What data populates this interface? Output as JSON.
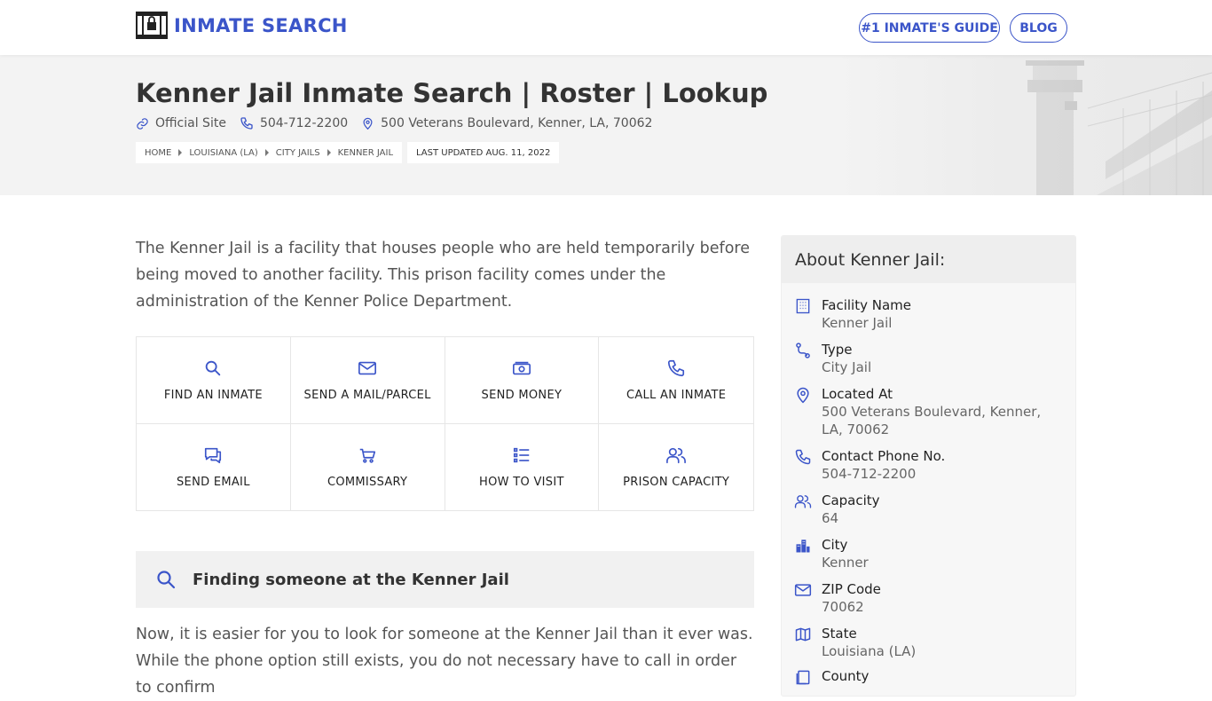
{
  "header": {
    "logo_text": "INMATE SEARCH",
    "nav": [
      {
        "label": "#1 INMATE'S GUIDE"
      },
      {
        "label": "BLOG"
      }
    ],
    "brand_color": "#3b55c9"
  },
  "hero": {
    "title": "Kenner Jail Inmate Search | Roster | Lookup",
    "official_site": "Official Site",
    "phone": "504-712-2200",
    "address": "500 Veterans Boulevard, Kenner, LA, 70062",
    "breadcrumbs": [
      "HOME",
      "LOUISIANA (LA)",
      "CITY JAILS",
      "KENNER JAIL"
    ],
    "last_updated": "LAST UPDATED AUG. 11, 2022"
  },
  "main": {
    "intro": "The Kenner Jail is a facility that houses people who are held temporarily before being moved to another facility. This prison facility comes under the administration of the Kenner Police Department.",
    "actions": [
      {
        "label": "FIND AN INMATE",
        "icon": "search-icon"
      },
      {
        "label": "SEND A MAIL/PARCEL",
        "icon": "mail-icon"
      },
      {
        "label": "SEND MONEY",
        "icon": "money-icon"
      },
      {
        "label": "CALL AN INMATE",
        "icon": "phone-icon"
      },
      {
        "label": "SEND EMAIL",
        "icon": "chat-icon"
      },
      {
        "label": "COMMISSARY",
        "icon": "cart-icon"
      },
      {
        "label": "HOW TO VISIT",
        "icon": "list-icon"
      },
      {
        "label": "PRISON CAPACITY",
        "icon": "users-icon"
      }
    ],
    "find_title": "Finding someone at the Kenner Jail",
    "para2": "Now, it is easier for you to look for someone at the Kenner Jail than it ever was. While the phone option still exists, you do not necessary have to call in order to confirm"
  },
  "sidebar": {
    "title": "About Kenner Jail:",
    "items": [
      {
        "label": "Facility Name",
        "value": "Kenner Jail",
        "icon": "building-icon"
      },
      {
        "label": "Type",
        "value": "City Jail",
        "icon": "route-icon"
      },
      {
        "label": "Located At",
        "value": "500 Veterans Boulevard, Kenner, LA, 70062",
        "icon": "location-pin-icon"
      },
      {
        "label": "Contact Phone No.",
        "value": "504-712-2200",
        "icon": "phone-icon"
      },
      {
        "label": "Capacity",
        "value": "64",
        "icon": "users-icon"
      },
      {
        "label": "City",
        "value": "Kenner",
        "icon": "city-icon"
      },
      {
        "label": "ZIP Code",
        "value": "70062",
        "icon": "mail-icon"
      },
      {
        "label": "State",
        "value": "Louisiana (LA)",
        "icon": "map-icon"
      },
      {
        "label": "County",
        "value": "",
        "icon": "copy-icon"
      }
    ]
  }
}
